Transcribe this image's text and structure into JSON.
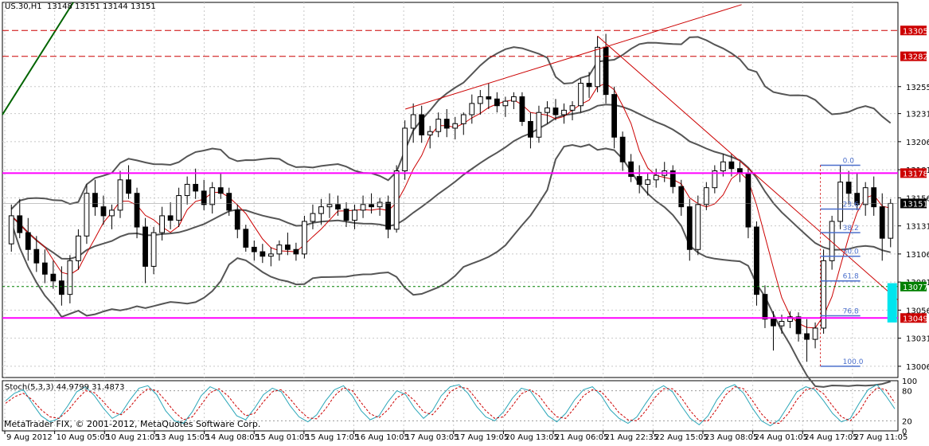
{
  "header": {
    "symbol": "US.30,H1",
    "ohlc": "13148 13151 13144 13151"
  },
  "indicator_header": "Stoch(5,3,3) 44.9799 31.4873",
  "copyright": "MetaTrader FIX, © 2001-2012, MetaQuotes Software Corp.",
  "colors": {
    "grid": "#c8c8c8",
    "candle": "#000000",
    "bollinger": "#555555",
    "ma": "#cc0000",
    "magenta": "#ff00ff",
    "red_level": "#cc0000",
    "fib": "#4b6fcc",
    "stoch_main": "#2aa6b8",
    "stoch_signal": "#cc0000",
    "green_label": "#008000",
    "cyan_rect": "#00e5ee"
  },
  "chart_data": [
    {
      "type": "candlestick",
      "title": "US.30,H1",
      "y_tick_labels": [
        "13255",
        "13231",
        "13206",
        "13181",
        "13156",
        "13131",
        "13106",
        "13081",
        "13056",
        "13031",
        "13006"
      ],
      "ylim": [
        12996,
        13330
      ],
      "x_tick_labels": [
        "9 Aug 2012",
        "10 Aug 05:05",
        "10 Aug 21:05",
        "13 Aug 15:05",
        "14 Aug 08:05",
        "15 Aug 01:05",
        "15 Aug 17:05",
        "16 Aug 10:05",
        "17 Aug 03:05",
        "17 Aug 19:05",
        "20 Aug 13:05",
        "21 Aug 06:05",
        "21 Aug 22:35",
        "22 Aug 15:05",
        "23 Aug 08:05",
        "24 Aug 01:05",
        "24 Aug 17:05",
        "27 Aug 11:05"
      ],
      "series": [
        {
          "ohlc": [
            [
              13115,
              13150,
              13108,
              13140
            ],
            [
              13140,
              13155,
              13120,
              13125
            ],
            [
              13125,
              13138,
              13100,
              13110
            ],
            [
              13110,
              13122,
              13090,
              13098
            ],
            [
              13098,
              13110,
              13080,
              13088
            ],
            [
              13088,
              13100,
              13075,
              13082
            ],
            [
              13082,
              13095,
              13060,
              13070
            ],
            [
              13070,
              13105,
              13062,
              13100
            ],
            [
              13100,
              13128,
              13092,
              13122
            ],
            [
              13122,
              13168,
              13115,
              13160
            ],
            [
              13160,
              13172,
              13140,
              13148
            ],
            [
              13148,
              13158,
              13132,
              13140
            ],
            [
              13140,
              13150,
              13128,
              13145
            ],
            [
              13145,
              13180,
              13138,
              13172
            ],
            [
              13172,
              13185,
              13155,
              13160
            ],
            [
              13160,
              13165,
              13120,
              13130
            ],
            [
              13130,
              13138,
              13080,
              13095
            ],
            [
              13095,
              13130,
              13088,
              13125
            ],
            [
              13125,
              13148,
              13118,
              13140
            ],
            [
              13140,
              13152,
              13128,
              13136
            ],
            [
              13136,
              13165,
              13130,
              13158
            ],
            [
              13158,
              13175,
              13150,
              13168
            ],
            [
              13168,
              13182,
              13155,
              13162
            ],
            [
              13162,
              13172,
              13145,
              13150
            ],
            [
              13150,
              13170,
              13142,
              13165
            ],
            [
              13165,
              13178,
              13155,
              13160
            ],
            [
              13160,
              13165,
              13140,
              13145
            ],
            [
              13145,
              13150,
              13120,
              13128
            ],
            [
              13128,
              13132,
              13108,
              13112
            ],
            [
              13112,
              13118,
              13100,
              13108
            ],
            [
              13108,
              13115,
              13098,
              13104
            ],
            [
              13104,
              13112,
              13095,
              13106
            ],
            [
              13106,
              13118,
              13100,
              13114
            ],
            [
              13114,
              13125,
              13105,
              13110
            ],
            [
              13110,
              13116,
              13100,
              13106
            ],
            [
              13106,
              13140,
              13102,
              13135
            ],
            [
              13135,
              13150,
              13128,
              13142
            ],
            [
              13142,
              13155,
              13132,
              13148
            ],
            [
              13148,
              13160,
              13138,
              13150
            ],
            [
              13150,
              13158,
              13140,
              13146
            ],
            [
              13146,
              13152,
              13130,
              13136
            ],
            [
              13136,
              13150,
              13128,
              13145
            ],
            [
              13145,
              13158,
              13138,
              13150
            ],
            [
              13150,
              13160,
              13142,
              13148
            ],
            [
              13148,
              13156,
              13140,
              13152
            ],
            [
              13152,
              13158,
              13120,
              13128
            ],
            [
              13128,
              13185,
              13125,
              13180
            ],
            [
              13180,
              13225,
              13172,
              13218
            ],
            [
              13218,
              13240,
              13205,
              13230
            ],
            [
              13230,
              13238,
              13205,
              13212
            ],
            [
              13212,
              13220,
              13200,
              13215
            ],
            [
              13215,
              13232,
              13210,
              13226
            ],
            [
              13226,
              13235,
              13210,
              13218
            ],
            [
              13218,
              13228,
              13208,
              13222
            ],
            [
              13222,
              13232,
              13212,
              13230
            ],
            [
              13230,
              13248,
              13222,
              13240
            ],
            [
              13240,
              13252,
              13230,
              13246
            ],
            [
              13246,
              13258,
              13235,
              13244
            ],
            [
              13244,
              13250,
              13232,
              13238
            ],
            [
              13238,
              13246,
              13228,
              13242
            ],
            [
              13242,
              13250,
              13235,
              13246
            ],
            [
              13246,
              13250,
              13220,
              13224
            ],
            [
              13224,
              13232,
              13200,
              13210
            ],
            [
              13210,
              13238,
              13205,
              13232
            ],
            [
              13232,
              13242,
              13222,
              13236
            ],
            [
              13236,
              13244,
              13225,
              13230
            ],
            [
              13230,
              13240,
              13222,
              13234
            ],
            [
              13234,
              13242,
              13225,
              13238
            ],
            [
              13238,
              13262,
              13232,
              13258
            ],
            [
              13258,
              13268,
              13245,
              13255
            ],
            [
              13255,
              13300,
              13250,
              13290
            ],
            [
              13290,
              13302,
              13240,
              13248
            ],
            [
              13248,
              13255,
              13200,
              13210
            ],
            [
              13210,
              13215,
              13180,
              13188
            ],
            [
              13188,
              13195,
              13170,
              13175
            ],
            [
              13175,
              13185,
              13160,
              13168
            ],
            [
              13168,
              13178,
              13158,
              13172
            ],
            [
              13172,
              13182,
              13165,
              13176
            ],
            [
              13176,
              13188,
              13170,
              13180
            ],
            [
              13180,
              13185,
              13160,
              13166
            ],
            [
              13166,
              13172,
              13140,
              13148
            ],
            [
              13148,
              13155,
              13100,
              13110
            ],
            [
              13110,
              13158,
              13105,
              13150
            ],
            [
              13150,
              13170,
              13145,
              13165
            ],
            [
              13165,
              13185,
              13160,
              13180
            ],
            [
              13180,
              13195,
              13175,
              13188
            ],
            [
              13188,
              13195,
              13175,
              13182
            ],
            [
              13182,
              13188,
              13170,
              13178
            ],
            [
              13178,
              13182,
              13120,
              13130
            ],
            [
              13130,
              13135,
              13060,
              13070
            ],
            [
              13070,
              13078,
              13040,
              13048
            ],
            [
              13048,
              13055,
              13020,
              13042
            ],
            [
              13042,
              13052,
              13035,
              13046
            ],
            [
              13046,
              13055,
              13040,
              13050
            ],
            [
              13050,
              13054,
              13028,
              13035
            ],
            [
              13035,
              13048,
              13010,
              13030
            ],
            [
              13030,
              13045,
              13022,
              13040
            ],
            [
              13040,
              13110,
              13035,
              13100
            ],
            [
              13100,
              13140,
              13092,
              13135
            ],
            [
              13135,
              13185,
              13128,
              13170
            ],
            [
              13170,
              13180,
              13150,
              13160
            ],
            [
              13160,
              13178,
              13145,
              13150
            ],
            [
              13150,
              13170,
              13140,
              13165
            ],
            [
              13165,
              13175,
              13140,
              13148
            ],
            [
              13148,
              13160,
              13100,
              13120
            ],
            [
              13120,
              13155,
              13112,
              13151
            ]
          ]
        }
      ],
      "levels": [
        {
          "value": 13305,
          "label": "13305",
          "style": "red-dashed"
        },
        {
          "value": 13282,
          "label": "13282",
          "style": "red-dashed"
        },
        {
          "value": 13178,
          "label": "13178",
          "style": "magenta"
        },
        {
          "value": 13151,
          "label": "13151",
          "style": "current"
        },
        {
          "value": 13077,
          "label": "13077",
          "style": "green"
        },
        {
          "value": 13049,
          "label": "13049",
          "style": "magenta"
        }
      ],
      "fibonacci": [
        {
          "ratio": "0.0",
          "value": 13185
        },
        {
          "ratio": "23.6",
          "value": 13146
        },
        {
          "ratio": "38.2",
          "value": 13125
        },
        {
          "ratio": "50.0",
          "value": 13104
        },
        {
          "ratio": "61.8",
          "value": 13082
        },
        {
          "ratio": "76.8",
          "value": 13051
        },
        {
          "ratio": "100.0",
          "value": 13006
        }
      ]
    },
    {
      "type": "line",
      "title": "Stoch(5,3,3) 44.9799 31.4873",
      "y_tick_labels": [
        "100",
        "80",
        "20",
        "0"
      ],
      "ylim": [
        0,
        100
      ],
      "series": [
        {
          "values": [
            60,
            75,
            82,
            55,
            30,
            18,
            25,
            50,
            78,
            88,
            70,
            45,
            25,
            35,
            62,
            85,
            90,
            72,
            40,
            20,
            15,
            38,
            70,
            88,
            80,
            55,
            30,
            22,
            45,
            72,
            85,
            78,
            50,
            28,
            18,
            32,
            60,
            82,
            90,
            70,
            40,
            22,
            30,
            58,
            80,
            72,
            45,
            25,
            40,
            70,
            88,
            92,
            75,
            48,
            28,
            20,
            38,
            65,
            85,
            80,
            55,
            30,
            18,
            35,
            62,
            82,
            88,
            70,
            42,
            25,
            15,
            28,
            55,
            80,
            90,
            78,
            50,
            25,
            12,
            30,
            62,
            85,
            92,
            75,
            45,
            20,
            10,
            22,
            50,
            78,
            88,
            82,
            60,
            35,
            18,
            25,
            55,
            82,
            92,
            70,
            44
          ]
        },
        {
          "values": [
            55,
            68,
            75,
            62,
            42,
            28,
            25,
            40,
            62,
            80,
            76,
            58,
            38,
            32,
            48,
            70,
            84,
            80,
            60,
            38,
            22,
            28,
            52,
            76,
            84,
            70,
            48,
            30,
            35,
            58,
            78,
            82,
            64,
            42,
            26,
            24,
            44,
            70,
            86,
            80,
            56,
            34,
            26,
            42,
            66,
            76,
            60,
            38,
            32,
            52,
            78,
            88,
            84,
            62,
            40,
            25,
            28,
            50,
            74,
            82,
            70,
            46,
            28,
            25,
            46,
            70,
            82,
            78,
            58,
            36,
            22,
            20,
            40,
            66,
            84,
            84,
            66,
            40,
            20,
            20,
            44,
            72,
            88,
            84,
            60,
            34,
            16,
            15,
            34,
            62,
            82,
            86,
            74,
            50,
            28,
            20,
            38,
            68,
            86,
            82,
            56
          ]
        }
      ]
    }
  ]
}
